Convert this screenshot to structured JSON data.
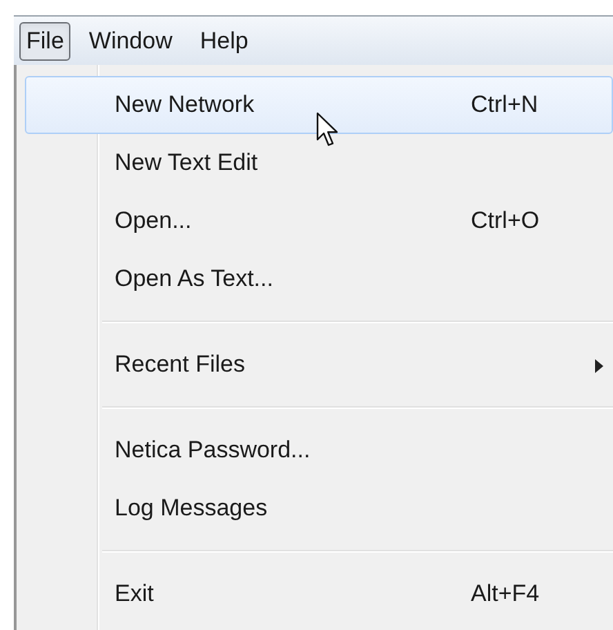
{
  "menubar": [
    {
      "label": "File",
      "selected": true
    },
    {
      "label": "Window",
      "selected": false
    },
    {
      "label": "Help",
      "selected": false
    }
  ],
  "menu": {
    "items": [
      {
        "kind": "item",
        "label": "New Network",
        "shortcut": "Ctrl+N",
        "selected": true
      },
      {
        "kind": "item",
        "label": "New Text Edit",
        "selected": false
      },
      {
        "kind": "item",
        "label": "Open...",
        "shortcut": "Ctrl+O",
        "selected": false
      },
      {
        "kind": "item",
        "label": "Open As Text...",
        "selected": false
      },
      {
        "kind": "separator"
      },
      {
        "kind": "item",
        "label": "Recent Files",
        "submenu": true,
        "selected": false
      },
      {
        "kind": "separator"
      },
      {
        "kind": "item",
        "label": "Netica Password...",
        "selected": false
      },
      {
        "kind": "item",
        "label": "Log Messages",
        "selected": false
      },
      {
        "kind": "separator"
      },
      {
        "kind": "item",
        "label": "Exit",
        "shortcut": "Alt+F4",
        "selected": false
      }
    ]
  }
}
